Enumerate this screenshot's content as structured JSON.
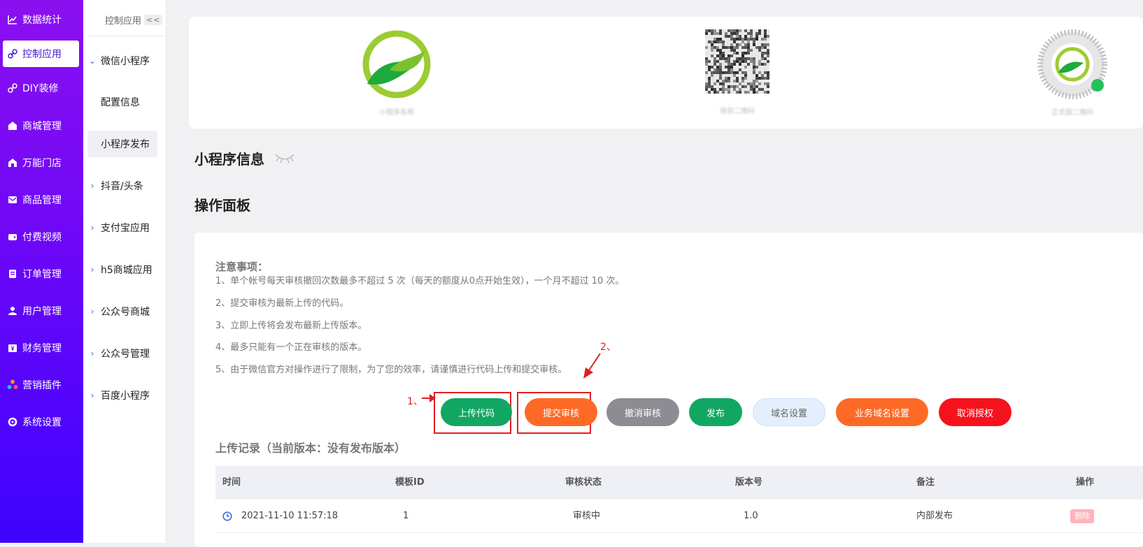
{
  "sidebar": {
    "items": [
      {
        "label": "数据统计",
        "icon": "chart-icon"
      },
      {
        "label": "控制应用",
        "icon": "link-icon"
      },
      {
        "label": "DIY装修",
        "icon": "link-icon"
      },
      {
        "label": "商城管理",
        "icon": "shop-icon"
      },
      {
        "label": "万能门店",
        "icon": "store-icon"
      },
      {
        "label": "商品管理",
        "icon": "mail-icon"
      },
      {
        "label": "付费视频",
        "icon": "wallet-icon"
      },
      {
        "label": "订单管理",
        "icon": "clipboard-icon"
      },
      {
        "label": "用户管理",
        "icon": "user-icon"
      },
      {
        "label": "财务管理",
        "icon": "finance-icon"
      },
      {
        "label": "营销插件",
        "icon": "plugin-icon"
      },
      {
        "label": "系统设置",
        "icon": "gear-icon"
      }
    ]
  },
  "subnav": {
    "title": "控制应用",
    "collapse_label": "<<",
    "items": [
      {
        "label": "微信小程序"
      },
      {
        "label": "配置信息"
      },
      {
        "label": "小程序发布"
      },
      {
        "label": "抖音/头条"
      },
      {
        "label": "支付宝应用"
      },
      {
        "label": "h5商城应用"
      },
      {
        "label": "公众号商城"
      },
      {
        "label": "公众号管理"
      },
      {
        "label": "百度小程序"
      }
    ]
  },
  "qr": {
    "captions": [
      "小程序名称",
      "体验二维码",
      "正式版二维码"
    ]
  },
  "main": {
    "section1_title": "小程序信息",
    "section2_title": "操作面板",
    "notice_title": "注意事项：",
    "notices": [
      "1、单个帐号每天审核撤回次数最多不超过 5 次（每天的额度从0点开始生效），一个月不超过 10 次。",
      "2、提交审核为最新上传的代码。",
      "3、立即上传将会发布最新上传版本。",
      "4、最多只能有一个正在审核的版本。",
      "5、由于微信官方对操作进行了限制，为了您的效率，请谨慎进行代码上传和提交审核。"
    ],
    "buttons": {
      "upload": "上传代码",
      "submit": "提交审核",
      "withdraw": "撤消审核",
      "publish": "发布",
      "domain": "域名设置",
      "biz_domain": "业务域名设置",
      "unauth": "取消授权"
    },
    "annotations": {
      "step1": "1、",
      "step2": "2、"
    },
    "records_title": "上传记录（当前版本：没有发布版本）",
    "table": {
      "headers": [
        "时间",
        "模板ID",
        "审核状态",
        "版本号",
        "备注",
        "操作"
      ],
      "rows": [
        {
          "time": "2021-11-10 11:57:18",
          "template_id": "1",
          "status": "审核中",
          "version": "1.0",
          "remark": "内部发布",
          "action": "删除"
        }
      ]
    }
  },
  "colors": {
    "green": "#11a762",
    "orange": "#fd6a26",
    "gray": "#8c8c93",
    "red": "#f5121d",
    "annotation": "#e02020"
  }
}
